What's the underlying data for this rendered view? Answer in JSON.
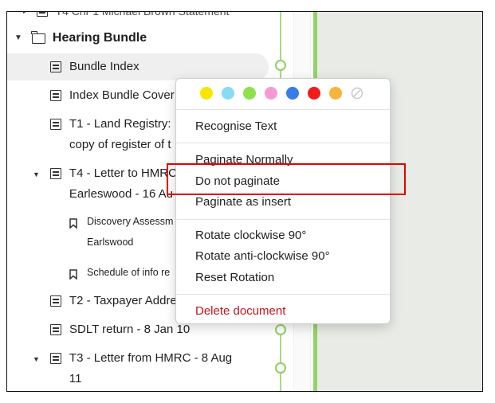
{
  "tree": {
    "cut_off_top": "T4 Chr 1 Michael Brown Statement",
    "folder": "Hearing Bundle",
    "items": [
      {
        "label": "Bundle Index"
      },
      {
        "label": "Index Bundle Cover"
      },
      {
        "label": "T1 - Land Registry:",
        "label2": "copy of register of t"
      },
      {
        "label": "T4 - Letter to HMRC",
        "label2": "Earleswood - 16 Au"
      },
      {
        "label": "Discovery Assessm",
        "label2": "Earlswood"
      },
      {
        "label": "Schedule of info re"
      },
      {
        "label": "T2 - Taxpayer Addre"
      },
      {
        "label": "SDLT return - 8 Jan 10"
      },
      {
        "label": "T3 - Letter from HMRC - 8 Aug",
        "label2": "11"
      }
    ]
  },
  "context_menu": {
    "color_swatches": [
      "#f6e600",
      "#87dcf3",
      "#8de14a",
      "#f49bd5",
      "#3a7bea",
      "#ee1c1c",
      "#f5b43c"
    ],
    "no_color_icon": "no-color-icon",
    "items": {
      "recognise_text": "Recognise Text",
      "paginate_normally": "Paginate Normally",
      "do_not_paginate": "Do not paginate",
      "paginate_as_insert": "Paginate as insert",
      "rotate_cw": "Rotate clockwise 90°",
      "rotate_acw": "Rotate anti-clockwise 90°",
      "reset_rotation": "Reset Rotation",
      "delete_document": "Delete document"
    }
  },
  "colors": {
    "timeline_green": "#94d36a",
    "highlight_red": "#e60000",
    "danger_red": "#c4141b"
  }
}
